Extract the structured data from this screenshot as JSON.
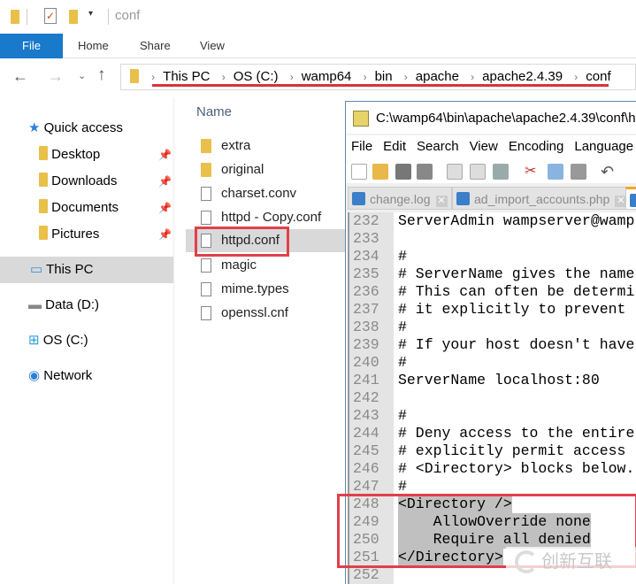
{
  "explorer": {
    "window_title": "conf",
    "ribbon_tabs": [
      "File",
      "Home",
      "Share",
      "View"
    ],
    "breadcrumb": [
      "This PC",
      "OS (C:)",
      "wamp64",
      "bin",
      "apache",
      "apache2.4.39",
      "conf"
    ],
    "sidebar": [
      {
        "label": "Quick access",
        "icon": "star-icon"
      },
      {
        "label": "Desktop",
        "icon": "desktop-folder-icon",
        "pinned": true
      },
      {
        "label": "Downloads",
        "icon": "downloads-folder-icon",
        "pinned": true
      },
      {
        "label": "Documents",
        "icon": "documents-folder-icon",
        "pinned": true
      },
      {
        "label": "Pictures",
        "icon": "pictures-folder-icon",
        "pinned": true
      },
      {
        "label": "This PC",
        "icon": "computer-icon",
        "selected": true
      },
      {
        "label": "Data (D:)",
        "icon": "drive-icon"
      },
      {
        "label": "OS (C:)",
        "icon": "windows-drive-icon"
      },
      {
        "label": "Network",
        "icon": "network-icon"
      }
    ],
    "column_header": "Name",
    "files": [
      {
        "name": "extra",
        "type": "folder"
      },
      {
        "name": "original",
        "type": "folder"
      },
      {
        "name": "charset.conv",
        "type": "file"
      },
      {
        "name": "httpd - Copy.conf",
        "type": "file"
      },
      {
        "name": "httpd.conf",
        "type": "file",
        "selected": true
      },
      {
        "name": "magic",
        "type": "file"
      },
      {
        "name": "mime.types",
        "type": "file"
      },
      {
        "name": "openssl.cnf",
        "type": "file"
      }
    ]
  },
  "notepad": {
    "title": "C:\\wamp64\\bin\\apache\\apache2.4.39\\conf\\h",
    "menu": [
      "File",
      "Edit",
      "Search",
      "View",
      "Encoding",
      "Language"
    ],
    "tabs": [
      "change.log",
      "ad_import_accounts.php"
    ],
    "lines": [
      {
        "n": "232",
        "t": "ServerAdmin wampserver@wamp"
      },
      {
        "n": "233",
        "t": ""
      },
      {
        "n": "234",
        "t": "#"
      },
      {
        "n": "235",
        "t": "# ServerName gives the name"
      },
      {
        "n": "236",
        "t": "# This can often be determi"
      },
      {
        "n": "237",
        "t": "# it explicitly to prevent "
      },
      {
        "n": "238",
        "t": "#"
      },
      {
        "n": "239",
        "t": "# If your host doesn't have"
      },
      {
        "n": "240",
        "t": "#"
      },
      {
        "n": "241",
        "t": "ServerName localhost:80"
      },
      {
        "n": "242",
        "t": ""
      },
      {
        "n": "243",
        "t": "#"
      },
      {
        "n": "244",
        "t": "# Deny access to the entire"
      },
      {
        "n": "245",
        "t": "# explicitly permit access "
      },
      {
        "n": "246",
        "t": "# <Directory> blocks below."
      },
      {
        "n": "247",
        "t": "#"
      },
      {
        "n": "248",
        "t": "<Directory />"
      },
      {
        "n": "249",
        "t": "    AllowOverride none"
      },
      {
        "n": "250",
        "t": "    Require all denied"
      },
      {
        "n": "251",
        "t": "</Directory>"
      },
      {
        "n": "252",
        "t": ""
      }
    ]
  },
  "watermark": "创新互联",
  "colors": {
    "accent": "#1979ca",
    "highlight": "#e0404b"
  }
}
